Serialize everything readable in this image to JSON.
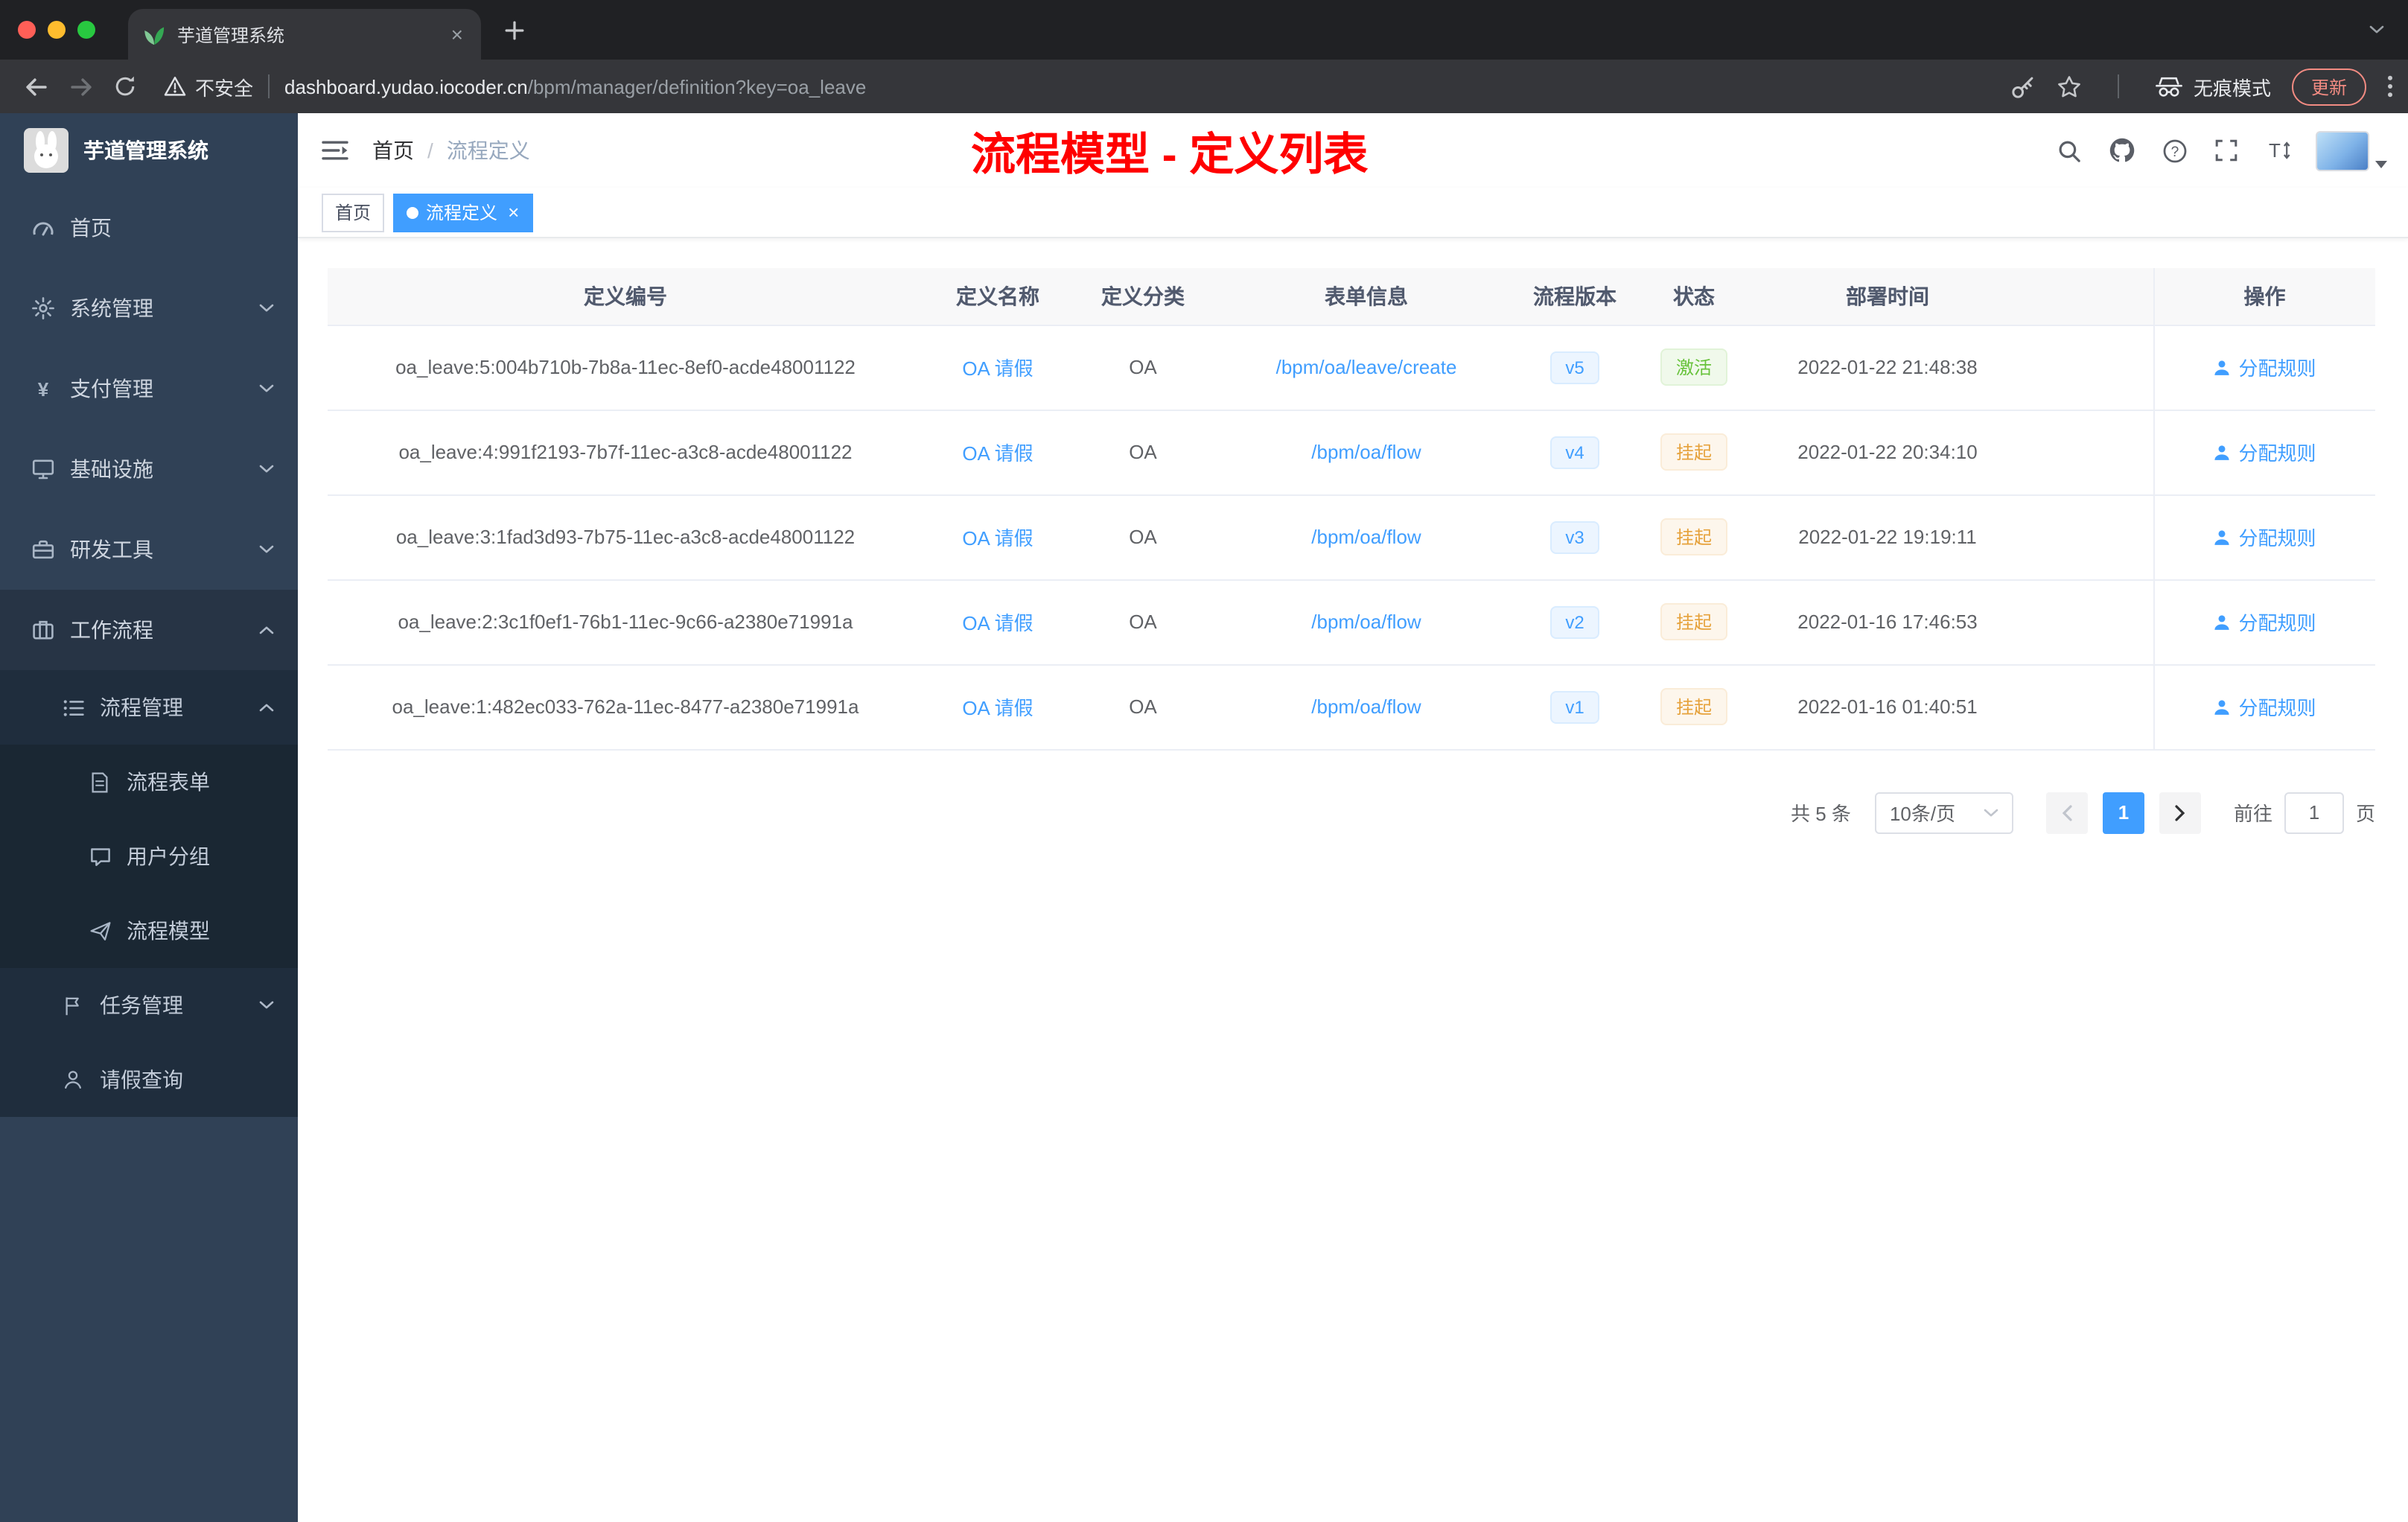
{
  "browser": {
    "tab": {
      "title": "芋道管理系统"
    },
    "security_label": "不安全",
    "url": {
      "host": "dashboard.yudao.iocoder.cn",
      "path": "/bpm/manager/definition?key=oa_leave"
    },
    "incognito_label": "无痕模式",
    "update_label": "更新"
  },
  "sidebar": {
    "app_title": "芋道管理系统",
    "items": [
      {
        "key": "home",
        "icon": "dashboard",
        "label": "首页",
        "level": 1
      },
      {
        "key": "system-management",
        "icon": "gear",
        "label": "系统管理",
        "level": 1,
        "chevron": "down"
      },
      {
        "key": "payment-management",
        "icon": "yen",
        "label": "支付管理",
        "level": 1,
        "chevron": "down"
      },
      {
        "key": "infrastructure",
        "icon": "monitor",
        "label": "基础设施",
        "level": 1,
        "chevron": "down"
      },
      {
        "key": "dev-tools",
        "icon": "toolbox",
        "label": "研发工具",
        "level": 1,
        "chevron": "down"
      },
      {
        "key": "workflow",
        "icon": "briefcase",
        "label": "工作流程",
        "level": 1,
        "chevron": "up",
        "open": true
      },
      {
        "key": "process-management",
        "icon": "list",
        "label": "流程管理",
        "level": 2,
        "chevron": "up"
      },
      {
        "key": "process-form",
        "icon": "document",
        "label": "流程表单",
        "level": 3
      },
      {
        "key": "user-group",
        "icon": "chat",
        "label": "用户分组",
        "level": 3
      },
      {
        "key": "process-model",
        "icon": "send",
        "label": "流程模型",
        "level": 3
      },
      {
        "key": "task-management",
        "icon": "flag",
        "label": "任务管理",
        "level": 2,
        "chevron": "down"
      },
      {
        "key": "leave-query",
        "icon": "user",
        "label": "请假查询",
        "level": 2
      }
    ]
  },
  "header": {
    "breadcrumb": {
      "root": "首页",
      "separator": "/",
      "current": "流程定义"
    },
    "annotation": "流程模型 - 定义列表",
    "actions": [
      "search",
      "github",
      "help",
      "fullscreen",
      "fontsize"
    ]
  },
  "tags": [
    {
      "label": "首页",
      "active": false,
      "closable": false
    },
    {
      "label": "流程定义",
      "active": true,
      "closable": true
    }
  ],
  "table": {
    "columns": [
      "定义编号",
      "定义名称",
      "定义分类",
      "表单信息",
      "流程版本",
      "状态",
      "部署时间",
      "操作"
    ],
    "rows": [
      {
        "id": "oa_leave:5:004b710b-7b8a-11ec-8ef0-acde48001122",
        "name": "OA 请假",
        "category": "OA",
        "form": "/bpm/oa/leave/create",
        "version": "v5",
        "status": "激活",
        "status_type": "success",
        "time": "2022-01-22 21:48:38",
        "action": "分配规则"
      },
      {
        "id": "oa_leave:4:991f2193-7b7f-11ec-a3c8-acde48001122",
        "name": "OA 请假",
        "category": "OA",
        "form": "/bpm/oa/flow",
        "version": "v4",
        "status": "挂起",
        "status_type": "warning",
        "time": "2022-01-22 20:34:10",
        "action": "分配规则"
      },
      {
        "id": "oa_leave:3:1fad3d93-7b75-11ec-a3c8-acde48001122",
        "name": "OA 请假",
        "category": "OA",
        "form": "/bpm/oa/flow",
        "version": "v3",
        "status": "挂起",
        "status_type": "warning",
        "time": "2022-01-22 19:19:11",
        "action": "分配规则"
      },
      {
        "id": "oa_leave:2:3c1f0ef1-76b1-11ec-9c66-a2380e71991a",
        "name": "OA 请假",
        "category": "OA",
        "form": "/bpm/oa/flow",
        "version": "v2",
        "status": "挂起",
        "status_type": "warning",
        "time": "2022-01-16 17:46:53",
        "action": "分配规则"
      },
      {
        "id": "oa_leave:1:482ec033-762a-11ec-8477-a2380e71991a",
        "name": "OA 请假",
        "category": "OA",
        "form": "/bpm/oa/flow",
        "version": "v1",
        "status": "挂起",
        "status_type": "warning",
        "time": "2022-01-16 01:40:51",
        "action": "分配规则"
      }
    ]
  },
  "pagination": {
    "total": "共 5 条",
    "page_size": "10条/页",
    "current_page": "1",
    "goto_label": "前往",
    "goto_value": "1",
    "page_unit": "页"
  },
  "colors": {
    "accent": "#409eff",
    "success": "#67c23a",
    "warning": "#e6a23c",
    "annotation_red": "#ff0000",
    "sidebar_bg": "#304156",
    "submenu_bg": "#1f2d3d"
  }
}
